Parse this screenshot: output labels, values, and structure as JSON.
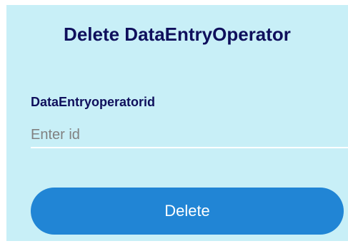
{
  "form": {
    "title": "Delete DataEntryOperator",
    "id_label": "DataEntryoperatorid",
    "id_value": "",
    "id_placeholder": "Enter id",
    "delete_label": "Delete"
  },
  "colors": {
    "panel_background": "#c8eff7",
    "heading_text": "#0f0f5c",
    "button_background": "#2185d5",
    "button_text": "#ffffff"
  }
}
